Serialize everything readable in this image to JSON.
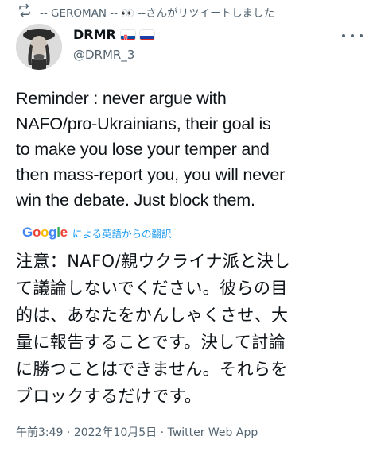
{
  "retweet_banner": {
    "text": "-- GEROMAN -- 👀 --さんがリツイートしました"
  },
  "author": {
    "name": "DRMR",
    "handle": "@DRMR_3",
    "flags": [
      "slovakia-flag-icon",
      "russia-flag-icon"
    ]
  },
  "tweet": {
    "lines": [
      "Reminder : never argue with",
      "NAFO/pro-Ukrainians, their goal is",
      "to make you lose your temper and",
      "then mass-report you, you will never",
      "win the debate. Just block them."
    ]
  },
  "translation": {
    "provider": "Google",
    "label": "による英語からの翻訳",
    "lines": [
      "注意：NAFO/親ウクライナ派と決し",
      "て議論しないでください。彼らの目",
      "的は、あなたをかんしゃくさせ、大",
      "量に報告することです。決して討論",
      "に勝つことはできません。それらを",
      "ブロックするだけです。"
    ]
  },
  "meta": {
    "time": "午前3:49",
    "date": "2022年10月5日",
    "source": "Twitter Web App",
    "separator": "·"
  },
  "colors": {
    "text": "#0f1419",
    "secondary": "#536471",
    "link": "#1d9bf0"
  }
}
